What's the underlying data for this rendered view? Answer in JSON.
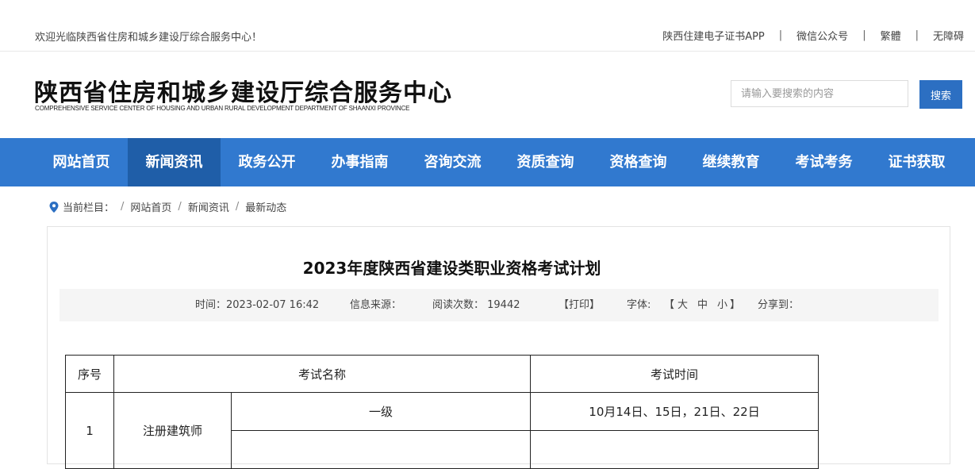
{
  "topbar": {
    "welcome": "欢迎光临陕西省住房和城乡建设厅综合服务中心！",
    "links": [
      "陕西住建电子证书APP",
      "微信公众号",
      "繁體",
      "无障碍"
    ],
    "separator": "|"
  },
  "header": {
    "title": "陕西省住房和城乡建设厅综合服务中心",
    "subtitle": "COMPREHENSIVE SERVICE CENTER OF HOUSING AND URBAN RURAL DEVELOPMENT DEPARTMENT OF SHAANXI PROVINCE",
    "search_placeholder": "请输入要搜索的内容",
    "search_button": "搜索"
  },
  "nav": {
    "items": [
      "网站首页",
      "新闻资讯",
      "政务公开",
      "办事指南",
      "咨询交流",
      "资质查询",
      "资格查询",
      "继续教育",
      "考试考务",
      "证书获取"
    ],
    "active_index": 1
  },
  "breadcrumb": {
    "label": "当前栏目：",
    "items": [
      "网站首页",
      "新闻资讯",
      "最新动态"
    ],
    "separator": "/"
  },
  "article": {
    "title": "2023年度陕西省建设类职业资格考试计划",
    "meta": {
      "time": "时间：2023-02-07 16:42",
      "source": "信息来源：",
      "reads": "阅读次数： 19442",
      "print": "【打印】",
      "font_label": "字体:",
      "font_open": "【",
      "font_large": "大",
      "font_medium": "中",
      "font_small": "小",
      "font_close": "】",
      "share": "分享到："
    }
  },
  "exam_table": {
    "headers": [
      "序号",
      "考试名称",
      "考试时间"
    ],
    "rows": [
      {
        "no": "1",
        "name": "注册建筑师",
        "level": "一级",
        "time": "10月14日、15日，21日、22日"
      }
    ]
  },
  "colors": {
    "nav_bg": "#3179cf",
    "nav_active": "#1f5ea8",
    "search_button": "#2c6fc2",
    "pin_icon": "#2c6fc2"
  }
}
